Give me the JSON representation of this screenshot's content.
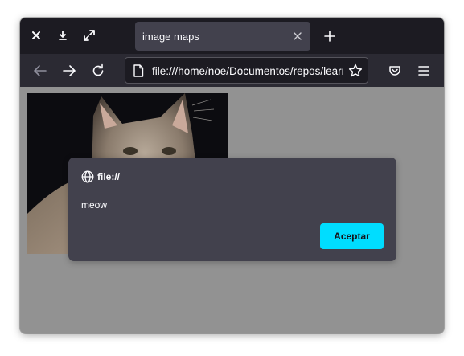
{
  "window": {
    "controls": [
      {
        "name": "close-window-icon"
      },
      {
        "name": "download-icon"
      },
      {
        "name": "fullscreen-icon"
      }
    ]
  },
  "tab": {
    "title": "image maps",
    "close_icon": "close-icon"
  },
  "new_tab_icon": "plus-icon",
  "nav": {
    "back_icon": "arrow-left-icon",
    "forward_icon": "arrow-right-icon",
    "reload_icon": "reload-icon",
    "url": "file:///home/noe/Documentos/repos/learning",
    "bookmark_icon": "star-icon",
    "pocket_icon": "pocket-icon",
    "menu_icon": "hamburger-menu-icon"
  },
  "page": {
    "image": "cat-photo"
  },
  "dialog": {
    "origin": "file://",
    "message": "meow",
    "ok_label": "Aceptar"
  },
  "colors": {
    "tabbar_bg": "#1c1b22",
    "navbar_bg": "#2b2a33",
    "content_bg": "#929292",
    "dialog_bg": "#42414d",
    "accent": "#00ddff"
  }
}
